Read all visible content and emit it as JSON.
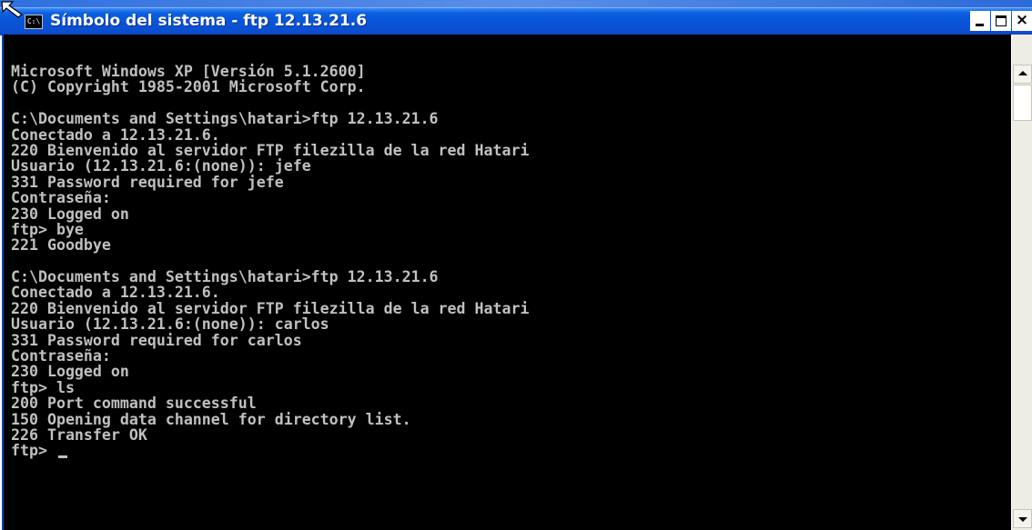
{
  "window": {
    "title": "Símbolo del sistema - ftp 12.13.21.6",
    "app_icon": "cmd-icon",
    "buttons": {
      "minimize_icon": "minimize-icon",
      "maximize_icon": "maximize-icon",
      "close_label": "×"
    }
  },
  "console": {
    "background": "#000000",
    "foreground": "#c0c0c0",
    "lines": [
      "Microsoft Windows XP [Versión 5.1.2600]",
      "(C) Copyright 1985-2001 Microsoft Corp.",
      "",
      "C:\\Documents and Settings\\hatari>ftp 12.13.21.6",
      "Conectado a 12.13.21.6.",
      "220 Bienvenido al servidor FTP filezilla de la red Hatari",
      "Usuario (12.13.21.6:(none)): jefe",
      "331 Password required for jefe",
      "Contraseña:",
      "230 Logged on",
      "ftp> bye",
      "221 Goodbye",
      "",
      "C:\\Documents and Settings\\hatari>ftp 12.13.21.6",
      "Conectado a 12.13.21.6.",
      "220 Bienvenido al servidor FTP filezilla de la red Hatari",
      "Usuario (12.13.21.6:(none)): carlos",
      "331 Password required for carlos",
      "Contraseña:",
      "230 Logged on",
      "ftp> ls",
      "200 Port command successful",
      "150 Opening data channel for directory list.",
      "226 Transfer OK",
      "ftp> "
    ]
  },
  "scrollbar": {
    "up_icon": "scroll-up-arrow-icon",
    "down_icon": "scroll-down-arrow-icon"
  },
  "colors": {
    "titlebar": "#0a52d6",
    "title_text": "#ffffff"
  }
}
